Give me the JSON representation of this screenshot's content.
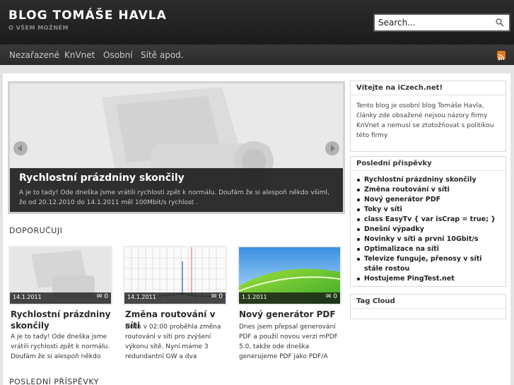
{
  "header": {
    "title": "BLOG TOMÁŠE HAVLA",
    "subtitle": "O VŠEM MOŽNÉM",
    "search_placeholder": "Search..."
  },
  "nav": {
    "items": [
      "Nezařazené",
      "KnVnet",
      "Osobní",
      "Sítě apod."
    ]
  },
  "slider": {
    "title": "Rychlostní prázdniny skončily",
    "text": "A je to tady! Ode dneška jsme vrátili rychlosti zpět k normálu. Doufám že si alespoň někdo všiml, že od 20.12.2010 do 14.1.2011 měl 100Mbit/s rychlost ."
  },
  "sections": {
    "recommended": "DOPORUČUJI",
    "latest": "POSLEDNÍ PŘÍSPĚVKY"
  },
  "cards": [
    {
      "date": "14.1.2011",
      "comments": "0",
      "title": "Rychlostní prázdniny skončily",
      "text": "A je to tady! Ode dneška jsme vrátili rychlosti zpět k normálu. Doufám že si alespoň někdo"
    },
    {
      "date": "14.1.2011",
      "comments": "0",
      "title": "Změna routování v síti",
      "text": "Dnes v 02:00 proběhla změna routování v síti pro zvýšení výkonu sítě. Nyní máme 3 redundantní GW a dva"
    },
    {
      "date": "1.1.2011",
      "comments": "0",
      "title": "Nový generátor PDF",
      "text": "Dnes jsem přepsal generování PDF a použil novou verzi mPDF 5.0, takže ode dneška generujeme PDF jako PDF/A"
    }
  ],
  "sidebar": {
    "welcome_title": "Vítejte na iCzech.net!",
    "welcome_text": "Tento blog je osobní blog Tomáše Havla, články zde obsažené nejsou názory firmy KnVnet a nemusí se ztotožňovat s politikou této firmy",
    "posts_title": "Poslední příspěvky",
    "posts": [
      "Rychlostní prázdniny skončily",
      "Změna routování v síti",
      "Nový generátor PDF",
      "Toky v síti",
      "class EasyTv { var isCrap = true; }",
      "Dnešní výpadky",
      "Novinky v síti a první 10Gbit/s",
      "Optimalizace na síti",
      "Televize funguje, přenosy v síti stále rostou",
      "Hostujeme PingTest.net"
    ],
    "tagcloud_title": "Tag Cloud"
  },
  "colors": {
    "header_bg": "#1c1c1c",
    "nav_bg": "#2b2b2b",
    "rss": "#e07a1f"
  }
}
